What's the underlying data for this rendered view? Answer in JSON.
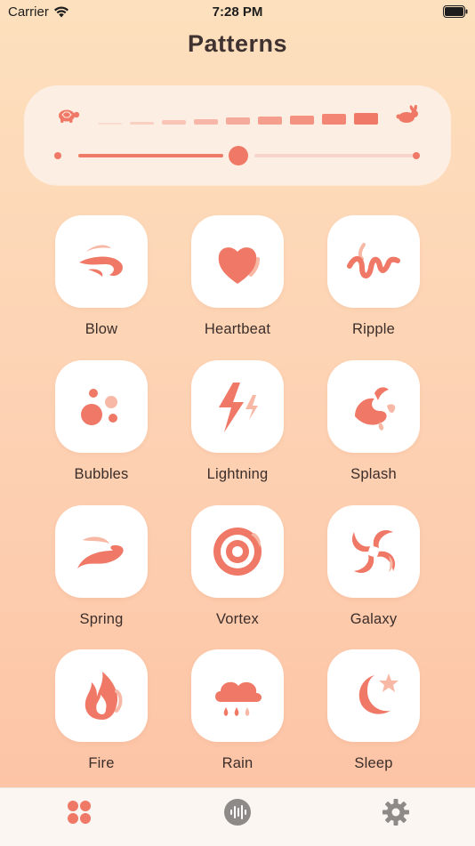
{
  "status": {
    "carrier": "Carrier",
    "time": "7:28 PM"
  },
  "title": "Patterns",
  "speed": {
    "min_icon": "turtle-icon",
    "max_icon": "rabbit-icon",
    "level_fraction": 0.5,
    "bar_count": 9,
    "bars_highlighted": 9
  },
  "patterns": [
    {
      "label": "Blow",
      "icon": "blow-icon"
    },
    {
      "label": "Heartbeat",
      "icon": "heartbeat-icon"
    },
    {
      "label": "Ripple",
      "icon": "ripple-icon"
    },
    {
      "label": "Bubbles",
      "icon": "bubbles-icon"
    },
    {
      "label": "Lightning",
      "icon": "lightning-icon"
    },
    {
      "label": "Splash",
      "icon": "splash-icon"
    },
    {
      "label": "Spring",
      "icon": "spring-icon"
    },
    {
      "label": "Vortex",
      "icon": "vortex-icon"
    },
    {
      "label": "Galaxy",
      "icon": "galaxy-icon"
    },
    {
      "label": "Fire",
      "icon": "fire-icon"
    },
    {
      "label": "Rain",
      "icon": "rain-icon"
    },
    {
      "label": "Sleep",
      "icon": "sleep-icon"
    }
  ],
  "tabs": [
    {
      "name": "patterns",
      "icon": "grid-icon",
      "active": true
    },
    {
      "name": "sound",
      "icon": "waveform-icon",
      "active": false
    },
    {
      "name": "settings",
      "icon": "gear-icon",
      "active": false
    }
  ],
  "colors": {
    "accent": "#f07866",
    "accent_light": "#f7b8a6",
    "tab_inactive": "#8e8a88"
  }
}
